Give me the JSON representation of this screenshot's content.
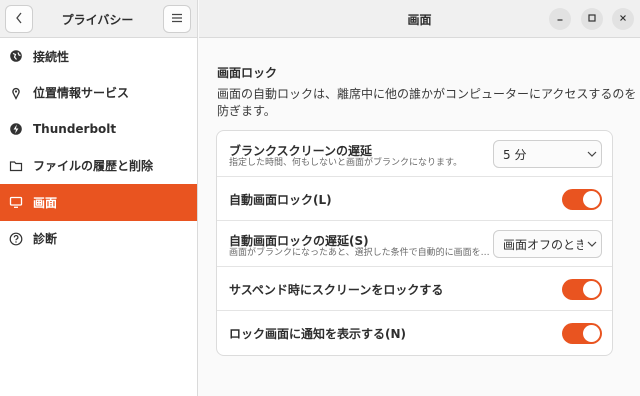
{
  "sidebar": {
    "title": "プライバシー",
    "items": [
      {
        "label": "接続性",
        "icon": "globe-icon"
      },
      {
        "label": "位置情報サービス",
        "icon": "location-pin-icon"
      },
      {
        "label": "Thunderbolt",
        "icon": "thunderbolt-icon"
      },
      {
        "label": "ファイルの履歴と削除",
        "icon": "folder-icon"
      },
      {
        "label": "画面",
        "icon": "monitor-icon",
        "active": true
      },
      {
        "label": "診断",
        "icon": "help-circle-icon"
      }
    ]
  },
  "header": {
    "title": "画面"
  },
  "section": {
    "title": "画面ロック",
    "description": "画面の自動ロックは、離席中に他の誰かがコンピューターにアクセスするのを防ぎます。"
  },
  "settings": [
    {
      "label": "ブランクスクリーンの遅延",
      "sub": "指定した時間、何もしないと画面がブランクになります。",
      "control": "dropdown",
      "value": "5 分"
    },
    {
      "label": "自動画面ロック(L)",
      "control": "toggle",
      "on": true
    },
    {
      "label": "自動画面ロックの遅延(S)",
      "sub": "画面がブランクになったあと、選択した条件で自動的に画面をロックします。",
      "control": "dropdown",
      "value": "画面オフのとき"
    },
    {
      "label": "サスペンド時にスクリーンをロックする",
      "control": "toggle",
      "on": true
    },
    {
      "label": "ロック画面に通知を表示する(N)",
      "control": "toggle",
      "on": true
    }
  ],
  "colors": {
    "accent": "#e95420"
  }
}
